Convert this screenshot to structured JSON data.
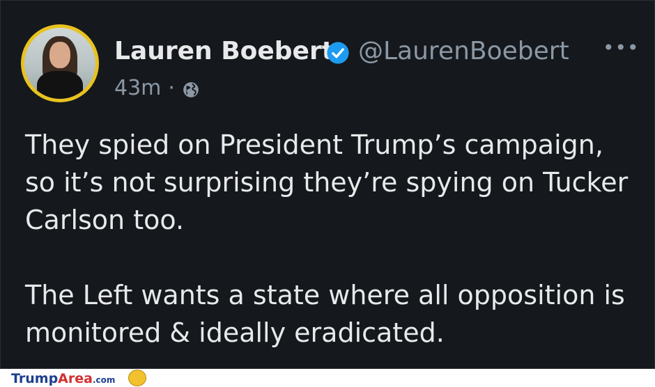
{
  "tweet": {
    "author_name": "Lauren Boebert",
    "handle": "@LaurenBoebert",
    "timestamp": "43m",
    "separator": "·",
    "visibility_icon": "globe-icon",
    "verified_icon": "verified-badge-icon",
    "more_label": "•••",
    "body_paragraphs": [
      "They spied on President Trump’s campaign, so it’s not surprising they’re spying on Tucker Carlson too.",
      "The Left wants a state where all opposition is monitored & ideally eradicated."
    ]
  },
  "watermark": {
    "part1": "Trump",
    "part2": "Area",
    "part3": ".com"
  },
  "colors": {
    "background": "#15181c",
    "text": "#e7e9ea",
    "secondary_text": "#8b98a5",
    "verified_blue": "#1d9bf0",
    "avatar_ring": "#e8c21f"
  }
}
